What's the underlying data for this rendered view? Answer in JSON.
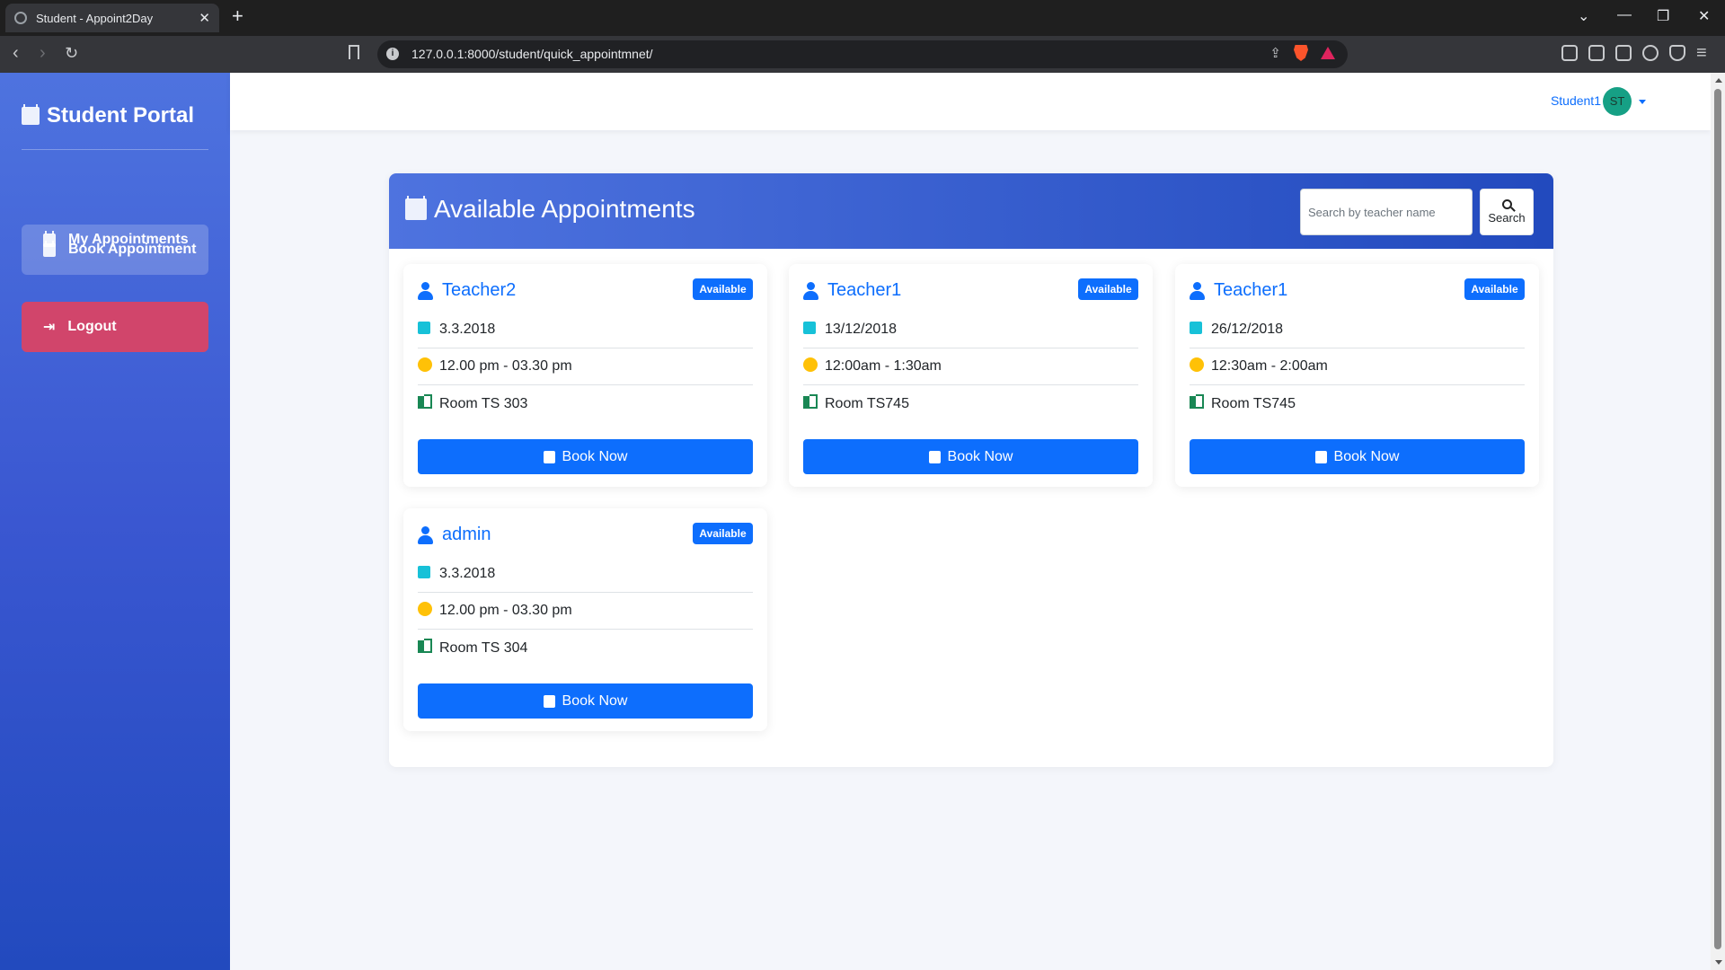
{
  "browser": {
    "tab_title": "Student - Appoint2Day",
    "url": "127.0.0.1:8000/student/quick_appointmnet/"
  },
  "sidebar": {
    "brand": "Student Portal",
    "items": [
      {
        "label": "My Appointments"
      },
      {
        "label": "Book Appointment"
      },
      {
        "label": "Logout"
      }
    ]
  },
  "topbar": {
    "user_name": "Student1",
    "avatar_initials": "ST"
  },
  "main": {
    "title": "Available Appointments",
    "search_placeholder": "Search by teacher name",
    "search_button": "Search"
  },
  "appointments": [
    {
      "teacher": "Teacher2",
      "status": "Available",
      "date": "3.3.2018",
      "time": "12.00 pm - 03.30 pm",
      "room": "Room TS 303",
      "button": "Book Now"
    },
    {
      "teacher": "Teacher1",
      "status": "Available",
      "date": "13/12/2018",
      "time": "12:00am - 1:30am",
      "room": "Room TS745",
      "button": "Book Now"
    },
    {
      "teacher": "Teacher1",
      "status": "Available",
      "date": "26/12/2018",
      "time": "12:30am - 2:00am",
      "room": "Room TS745",
      "button": "Book Now"
    },
    {
      "teacher": "admin",
      "status": "Available",
      "date": "3.3.2018",
      "time": "12.00 pm - 03.30 pm",
      "room": "Room TS 304",
      "button": "Book Now"
    }
  ],
  "colors": {
    "primary": "#0d6efd",
    "sidebar_gradient_start": "#4e73df",
    "sidebar_gradient_end": "#224abe",
    "logout": "#d1456b",
    "date_icon": "#17c1d8",
    "time_icon": "#ffc107",
    "room_icon": "#198754"
  }
}
